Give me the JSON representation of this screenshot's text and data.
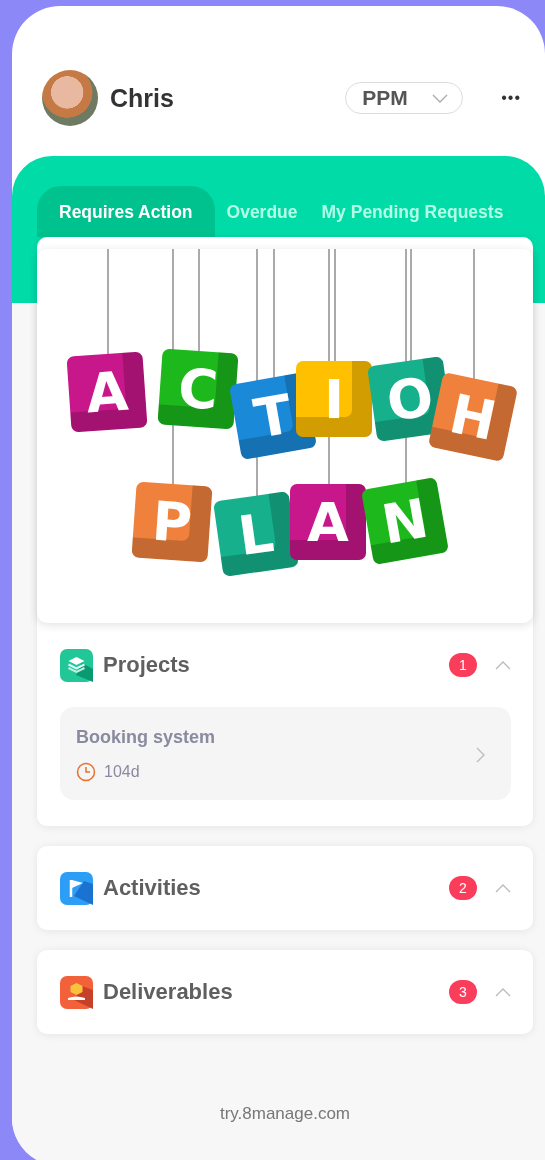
{
  "header": {
    "user_name": "Chris",
    "module": "PPM",
    "more": "•••"
  },
  "tabs": [
    {
      "label": "Requires Action",
      "selected": true
    },
    {
      "label": "Overdue",
      "selected": false
    },
    {
      "label": "My Pending Requests",
      "selected": false
    }
  ],
  "banner": {
    "tiles": [
      {
        "letter": "A",
        "color": "#c8178a"
      },
      {
        "letter": "C",
        "color": "#1cb81c"
      },
      {
        "letter": "T",
        "color": "#1a8ad8"
      },
      {
        "letter": "I",
        "color": "#ffc000"
      },
      {
        "letter": "O",
        "color": "#16b08c"
      },
      {
        "letter": "H",
        "color": "#f0813c"
      },
      {
        "letter": "P",
        "color": "#f0813c"
      },
      {
        "letter": "L",
        "color": "#16b08c"
      },
      {
        "letter": "A",
        "color": "#c8178a"
      },
      {
        "letter": "N",
        "color": "#1cb81c"
      }
    ]
  },
  "sections": [
    {
      "kind": "projects",
      "title": "Projects",
      "count": "1",
      "expanded": true,
      "items": [
        {
          "name": "Booking system",
          "duration": "104d"
        }
      ]
    },
    {
      "kind": "activities",
      "title": "Activities",
      "count": "2",
      "expanded": true
    },
    {
      "kind": "deliverables",
      "title": "Deliverables",
      "count": "3",
      "expanded": true
    }
  ],
  "footer": "try.8manage.com"
}
